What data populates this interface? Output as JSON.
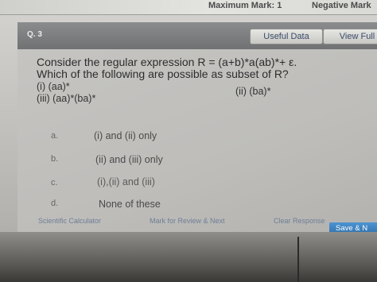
{
  "header": {
    "maximum_mark": "Maximum Mark: 1",
    "negative_mark": "Negative Mark"
  },
  "question_bar": {
    "label": "Q. 3",
    "useful_data": "Useful Data",
    "view_full": "View Full"
  },
  "question": {
    "line1": "Consider the regular expression R = (a+b)*a(ab)*+ ε.",
    "line2": "Which of the following are possible as subset of R?",
    "options": [
      {
        "label": "(i) (aa)*"
      },
      {
        "label": "(ii) (ba)*"
      },
      {
        "label": "(iii) (aa)*(ba)*"
      }
    ]
  },
  "answers": [
    {
      "letter": "a.",
      "text": "(i) and (ii) only"
    },
    {
      "letter": "b.",
      "text": "(ii) and (iii) only"
    },
    {
      "letter": "c.",
      "text": "(i),(ii) and (iii)"
    },
    {
      "letter": "d.",
      "text": "None of these"
    }
  ],
  "toolbar": {
    "calculator": "Scientific Calculator",
    "mark_review": "Mark for Review & Next",
    "clear": "Clear Response",
    "save": "Save & N"
  }
}
